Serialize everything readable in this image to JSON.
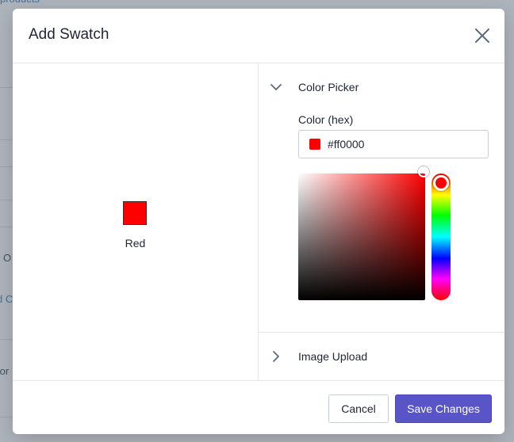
{
  "background": {
    "fragments": [
      {
        "text": "products",
        "link": true
      },
      {
        "text": ")",
        "link": false
      },
      {
        "text": "r O",
        "link": false
      },
      {
        "text": "d C",
        "link": true
      },
      {
        "text": "tor",
        "link": false
      }
    ]
  },
  "modal": {
    "title": "Add Swatch",
    "close_icon": "close-icon",
    "preview": {
      "label": "Red",
      "color": "#ff0000"
    },
    "sections": {
      "color_picker": {
        "title": "Color Picker",
        "expanded": true,
        "field_label": "Color (hex)",
        "hex_value": "#ff0000",
        "hue_degrees": 0,
        "saturation": 1,
        "brightness": 1
      },
      "image_upload": {
        "title": "Image Upload",
        "expanded": false
      }
    },
    "footer": {
      "cancel_label": "Cancel",
      "save_label": "Save Changes"
    }
  },
  "colors": {
    "accent": "#5a54c9",
    "swatch": "#ff0000",
    "chevron": "#5b6b7e"
  }
}
